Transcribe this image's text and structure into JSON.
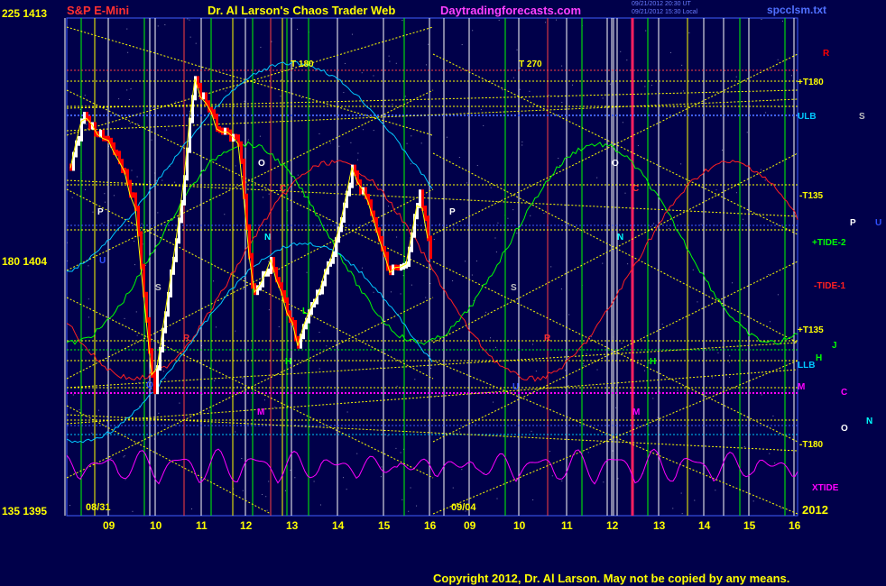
{
  "header": {
    "symbol": "S&P E-Mini",
    "title": "Dr. Al Larson's Chaos Trader Web",
    "site": "Daytradingforecasts.com",
    "file": "spcclsm.txt",
    "stamp1": "09/21/2012 20:30 UT",
    "stamp2": "09/21/2012 15:30 Local"
  },
  "y_axis_labels": [
    "225 1413",
    "180 1404",
    "135 1395"
  ],
  "copyright": "Copyright 2012, Dr. Al Larson. May not be copied by any means.",
  "right_labels": [
    {
      "text": "R",
      "color": "#ff0000"
    },
    {
      "text": "+T180",
      "color": "#ffff00"
    },
    {
      "text": "ULB",
      "color": "#00c8ff"
    },
    {
      "text": "S",
      "color": "#c0c0c0"
    },
    {
      "text": "-T135",
      "color": "#ffff00"
    },
    {
      "text": "P",
      "color": "#ffffff"
    },
    {
      "text": "U",
      "color": "#3050ff"
    },
    {
      "text": "+TIDE-2",
      "color": "#00ff00"
    },
    {
      "text": "-TIDE-1",
      "color": "#ff2020"
    },
    {
      "text": "+T135",
      "color": "#ffff00"
    },
    {
      "text": "J",
      "color": "#00ff00"
    },
    {
      "text": "H",
      "color": "#00ff00"
    },
    {
      "text": "LLB",
      "color": "#00c8ff"
    },
    {
      "text": "M",
      "color": "#ff00ff"
    },
    {
      "text": "C",
      "color": "#ff00ff"
    },
    {
      "text": "O",
      "color": "#ffffff"
    },
    {
      "text": "N",
      "color": "#00ffff"
    },
    {
      "text": "-T180",
      "color": "#ffff00"
    },
    {
      "text": "XTIDE",
      "color": "#ff00ff"
    },
    {
      "text": "2012",
      "color": "#ffff00"
    }
  ],
  "chart_data": {
    "type": "line",
    "y_axis": {
      "ticks": [
        1395,
        1404,
        1413
      ],
      "tick_degree_labels": [
        135,
        180,
        225
      ]
    },
    "x_tick_labels": [
      "09",
      "10",
      "11",
      "12",
      "13",
      "14",
      "15",
      "16",
      "09",
      "10",
      "11",
      "12",
      "13",
      "14",
      "15",
      "16"
    ],
    "date_markers": [
      "08/31",
      "09/04"
    ],
    "time_labels": [
      "T 180",
      "T 270"
    ],
    "event_markers": [
      "P",
      "O",
      "C",
      "N",
      "S",
      "R",
      "H",
      "M",
      "U",
      "Q",
      "L",
      "P",
      "O",
      "C",
      "N",
      "S",
      "R",
      "H",
      "M",
      "U"
    ],
    "series": [
      {
        "name": "XTIDE",
        "color": "#ff00ff"
      },
      {
        "name": "+TIDE-2",
        "color": "#00ff00"
      },
      {
        "name": "-TIDE-1",
        "color": "#ff2020"
      },
      {
        "name": "ULB",
        "color": "#00c8ff"
      },
      {
        "name": "LLB",
        "color": "#00c8ff"
      }
    ],
    "colors": {
      "background": "#00004a",
      "price_up": "#ffffff",
      "price_down": "#ff0000",
      "grid_yellow": "#ffff00",
      "grid_blue": "#4060ff"
    }
  }
}
